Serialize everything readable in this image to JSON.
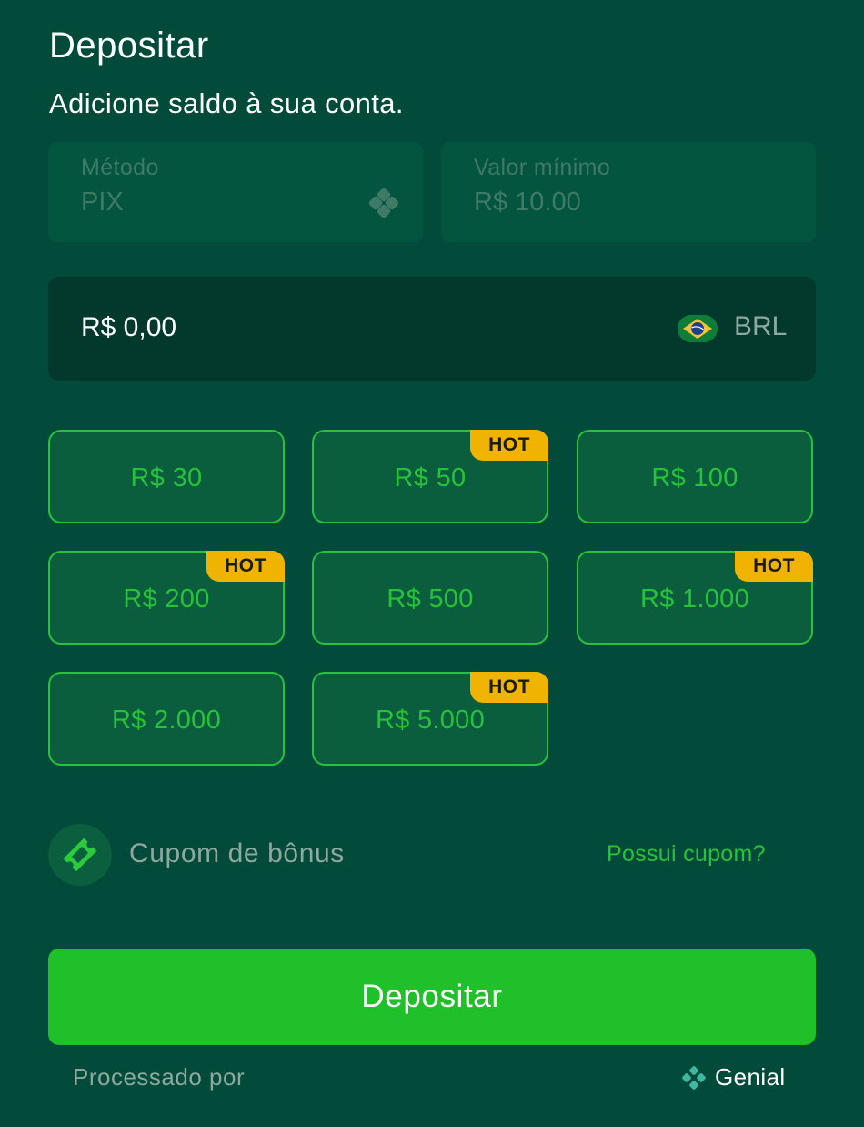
{
  "header": {
    "title": "Depositar",
    "subtitle": "Adicione saldo à sua conta."
  },
  "method": {
    "label": "Método",
    "value": "PIX",
    "icon": "pix-icon"
  },
  "min_value": {
    "label": "Valor mínimo",
    "value": "R$ 10.00"
  },
  "amount": {
    "value": "R$ 0,00",
    "currency": "BRL",
    "flag_icon": "brazil-flag-icon"
  },
  "quick_amounts": [
    {
      "label": "R$ 30",
      "hot": false
    },
    {
      "label": "R$ 50",
      "hot": true
    },
    {
      "label": "R$ 100",
      "hot": false
    },
    {
      "label": "R$ 200",
      "hot": true
    },
    {
      "label": "R$ 500",
      "hot": false
    },
    {
      "label": "R$ 1.000",
      "hot": true
    },
    {
      "label": "R$ 2.000",
      "hot": false
    },
    {
      "label": "R$ 5.000",
      "hot": true
    }
  ],
  "hot_label": "HOT",
  "coupon": {
    "label": "Cupom de bônus",
    "link": "Possui cupom?",
    "icon": "ticket-icon"
  },
  "deposit_button": "Depositar",
  "footer": {
    "processed_by": "Processado por",
    "provider": "Genial",
    "provider_icon": "genial-icon"
  },
  "colors": {
    "background": "#024a3a",
    "accent_green": "#20c02a",
    "hot_badge": "#f0b400",
    "amount_field": "#03382d"
  }
}
